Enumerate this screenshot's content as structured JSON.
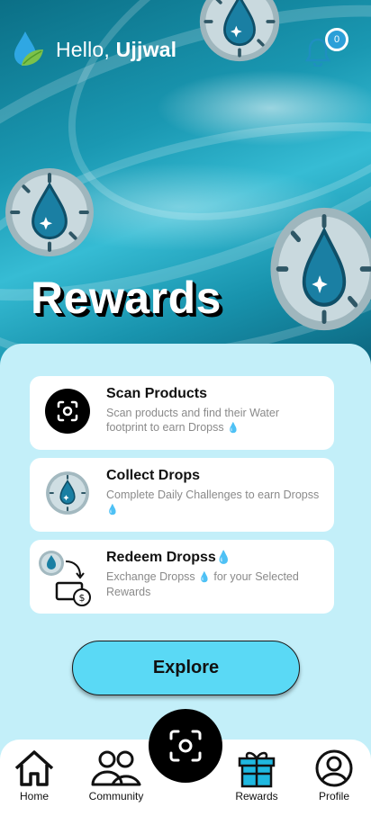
{
  "header": {
    "greeting": "Hello,",
    "user_name": "Ujjwal",
    "notification_count": "0"
  },
  "hero": {
    "title": "Rewards"
  },
  "cards": [
    {
      "title": "Scan Products",
      "desc": "Scan products and find their Water footprint to earn Dropss",
      "icon": "scan-icon"
    },
    {
      "title": "Collect Drops",
      "desc": "Complete Daily Challenges to earn Dropss",
      "icon": "drop-coin-icon"
    },
    {
      "title": "Redeem Dropss",
      "desc": "Exchange Dropss",
      "desc_suffix": "for your Selected Rewards",
      "icon": "redeem-icon"
    }
  ],
  "explore_label": "Explore",
  "nav": {
    "home": "Home",
    "community": "Community",
    "rewards": "Rewards",
    "profile": "Profile"
  },
  "colors": {
    "accent": "#5ad9f5",
    "panel": "#c3eff9",
    "rewards_icon": "#1fb8e0"
  }
}
